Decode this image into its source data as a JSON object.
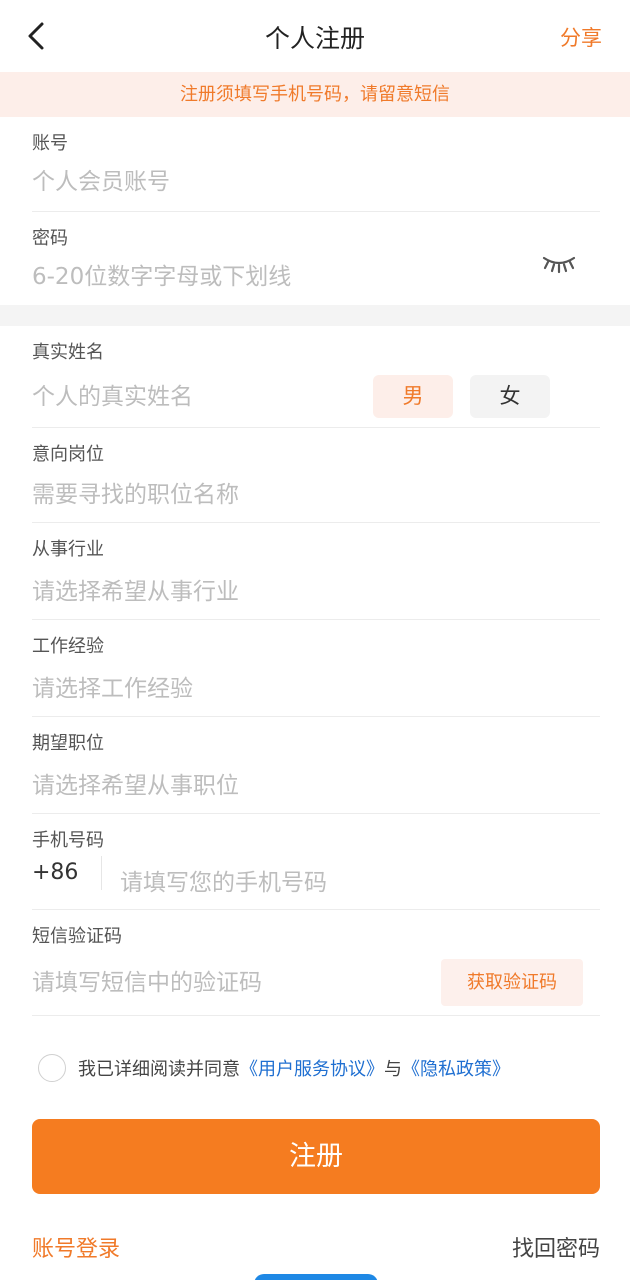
{
  "header": {
    "title": "个人注册",
    "share_label": "分享"
  },
  "notice": "注册须填写手机号码，请留意短信",
  "account": {
    "label": "账号",
    "placeholder": "个人会员账号"
  },
  "password": {
    "label": "密码",
    "placeholder": "6-20位数字字母或下划线"
  },
  "real_name": {
    "label": "真实姓名",
    "placeholder": "个人的真实姓名",
    "male_label": "男",
    "female_label": "女",
    "selected": "男"
  },
  "job_intent": {
    "label": "意向岗位",
    "placeholder": "需要寻找的职位名称"
  },
  "industry": {
    "label": "从事行业",
    "placeholder": "请选择希望从事行业"
  },
  "experience": {
    "label": "工作经验",
    "placeholder": "请选择工作经验"
  },
  "expected_position": {
    "label": "期望职位",
    "placeholder": "请选择希望从事职位"
  },
  "phone": {
    "label": "手机号码",
    "prefix": "+86",
    "placeholder": "请填写您的手机号码"
  },
  "sms_code": {
    "label": "短信验证码",
    "placeholder": "请填写短信中的验证码",
    "button_label": "获取验证码"
  },
  "agreement": {
    "prefix": "我已详细阅读并同意",
    "terms_link": "《用户服务协议》",
    "conjunction": "与",
    "privacy_link": "《隐私政策》",
    "checked": false
  },
  "register_label": "注册",
  "footer": {
    "login_link": "账号登录",
    "recover_link": "找回密码"
  },
  "colors": {
    "accent": "#f57c20",
    "notice_bg": "#fdeee9",
    "link": "#1f6fd1"
  }
}
